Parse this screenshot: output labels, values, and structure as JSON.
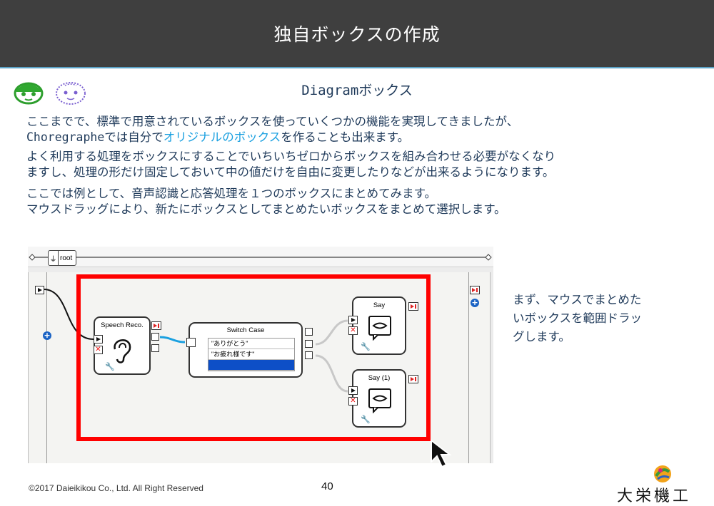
{
  "slide": {
    "title": "独自ボックスの作成",
    "subtitle": "Diagramボックス",
    "paragraphs": {
      "p1_line1": "ここまでで、標準で用意されているボックスを使っていくつかの機能を実現してきましたが、",
      "p1_line2_a": "Choregrapheでは自分で",
      "p1_line2_hl": "オリジナルのボックス",
      "p1_line2_b": "を作ることも出来ます。",
      "p2_line1": "よく利用する処理をボックスにすることでいちいちゼロからボックスを組み合わせる必要がなくなり",
      "p2_line2": "ますし、処理の形だけ固定しておいて中の値だけを自由に変更したりなどが出来るようになります。",
      "p3_line1": "ここでは例として、音声認識と応答処理を１つのボックスにまとめてみます。",
      "p3_line2": "マウスドラッグにより、新たにボックスとしてまとめたいボックスをまとめて選択します。"
    },
    "note_lines": [
      "まず、マウスでまとめた",
      "いボックスを範囲ドラッ",
      "グします。"
    ],
    "footer": "©2017 Daieikikou Co., Ltd. All Right Reserved",
    "page_number": "40",
    "company_logo": "大栄機工"
  },
  "diagram": {
    "breadcrumb_root": "root",
    "boxes": {
      "speech": "Speech Reco.",
      "switch": "Switch Case",
      "say": "Say",
      "say1": "Say (1)"
    },
    "switch_cases": [
      "\"ありがとう\"",
      "\"お疲れ様です\"",
      ""
    ]
  },
  "colors": {
    "title_bg": "#3f3f3f",
    "text": "#1f3a5a",
    "highlight": "#1aa0e0",
    "selection": "#ff0000"
  }
}
